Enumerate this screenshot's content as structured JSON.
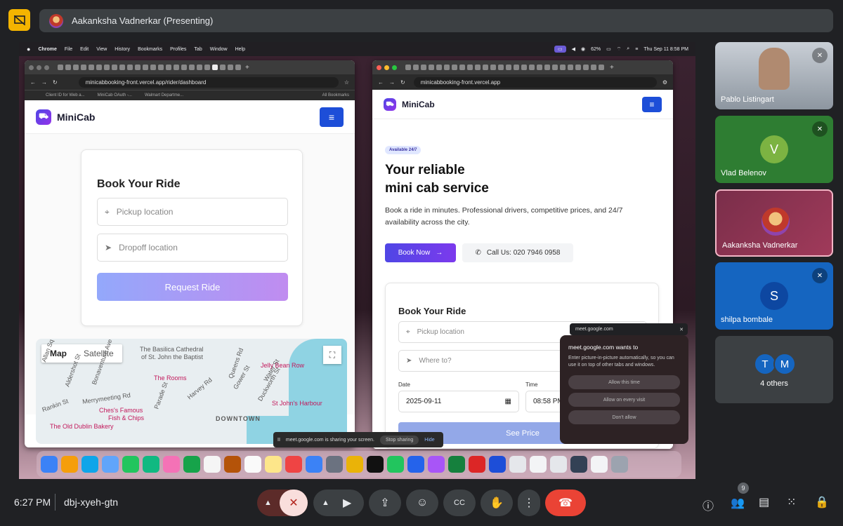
{
  "meet": {
    "presenter_label": "Aakanksha Vadnerkar (Presenting)",
    "time": "6:27 PM",
    "meeting_code": "dbj-xyeh-gtn",
    "participant_count": "9",
    "participants": [
      {
        "name": "Pablo Listingart",
        "initial": "",
        "muted": true
      },
      {
        "name": "Vlad Belenov",
        "initial": "V",
        "muted": true
      },
      {
        "name": "Aakanksha Vadnerkar",
        "initial": "",
        "muted": false
      },
      {
        "name": "shilpa bombale",
        "initial": "S",
        "muted": true
      }
    ],
    "others": {
      "initials": [
        "T",
        "M"
      ],
      "label": "4 others"
    }
  },
  "mac": {
    "apple": "",
    "app": "Chrome",
    "menus": [
      "File",
      "Edit",
      "View",
      "History",
      "Bookmarks",
      "Profiles",
      "Tab",
      "Window",
      "Help"
    ],
    "battery": "62%",
    "clock": "Thu Sep 11  8:58 PM"
  },
  "left_window": {
    "url": "minicabbooking-front.vercel.app/rider/dashboard",
    "bookmarks": [
      "Client ID for Web a...",
      "MiniCab OAuth -...",
      "Walmart Departme...",
      "All Bookmarks"
    ],
    "brand": "MiniCab",
    "form_title": "Book Your Ride",
    "pickup_placeholder": "Pickup location",
    "dropoff_placeholder": "Dropoff location",
    "request_btn": "Request Ride",
    "map": {
      "tab_map": "Map",
      "tab_satellite": "Satellite",
      "labels": [
        "The Basilica Cathedral",
        "of St. John the Baptist",
        "Jelly Bean Row",
        "The Rooms",
        "Merrymeeting Rd",
        "St John's Harbour",
        "Ches's Famous",
        "Fish & Chips",
        "DOWNTOWN",
        "The Old Dublin Bakery",
        "Harvey Rd",
        "Queens Rd",
        "Aldershot St",
        "Rankin St",
        "Parade St",
        "Gower St",
        "Duckworth St",
        "Water St",
        "Bonaventure Ave",
        "Allan Sq"
      ]
    }
  },
  "right_window": {
    "url": "minicabbooking-front.vercel.app",
    "brand": "MiniCab",
    "badge": "Available 24/7",
    "hero_line1": "Your reliable",
    "hero_line2": "mini cab service",
    "hero_desc": "Book a ride in minutes. Professional drivers, competitive prices, and 24/7 availability across the city.",
    "book_now": "Book Now",
    "call_us": "Call Us: 020 7946 0958",
    "form_title": "Book Your Ride",
    "pickup_placeholder": "Pickup location",
    "where_placeholder": "Where to?",
    "date_label": "Date",
    "date_value": "2025-09-11",
    "time_label": "Time",
    "time_value": "08:58 PM",
    "see_price": "See Price"
  },
  "share_banner": {
    "text": "meet.google.com is sharing your screen.",
    "stop": "Stop sharing",
    "hide": "Hide"
  },
  "pip": {
    "bar_title": "meet.google.com",
    "title": "meet.google.com wants to",
    "desc": "Enter picture-in-picture automatically, so you can use it on top of other tabs and windows.",
    "allow_once": "Allow this time",
    "allow_every": "Allow on every visit",
    "deny": "Don't allow"
  },
  "colors": {
    "brand_gradient_start": "#4f46e5",
    "brand_gradient_end": "#9333ea",
    "end_call": "#ea4335",
    "present_icon": "#f4b400"
  }
}
